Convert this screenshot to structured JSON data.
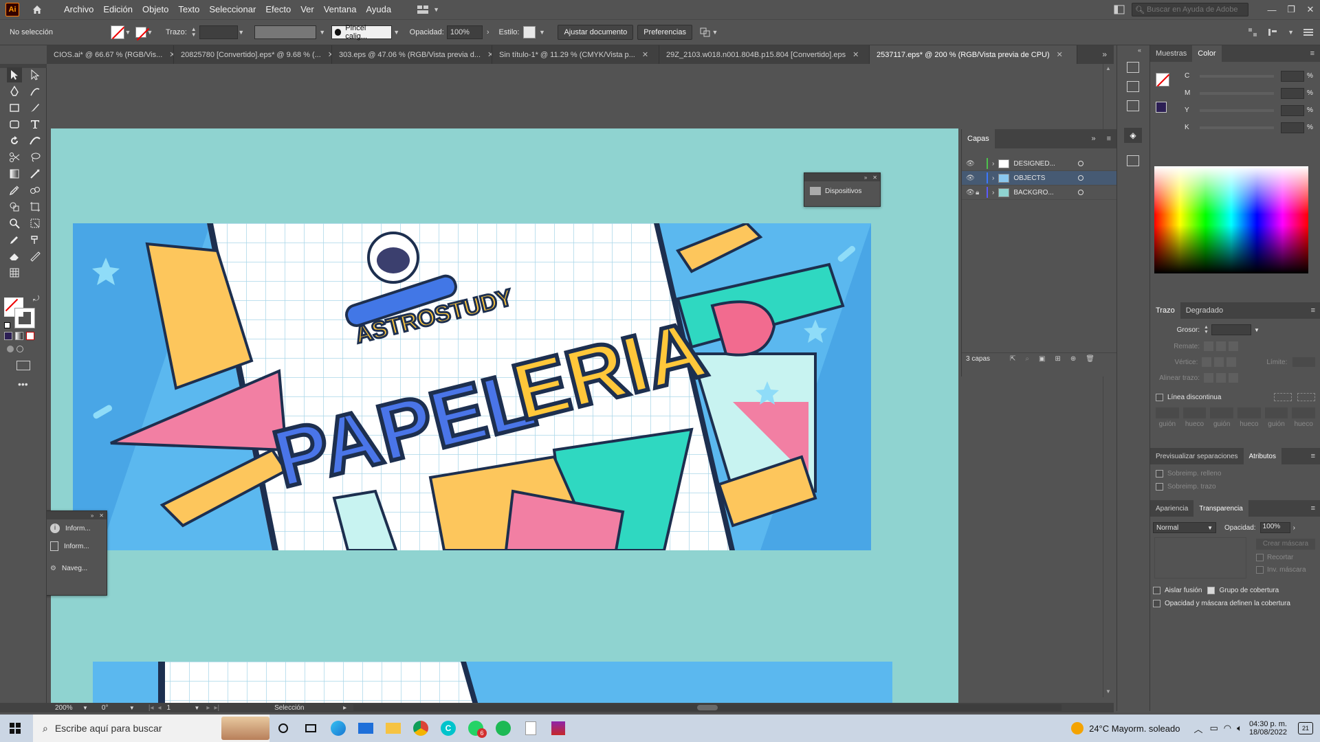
{
  "menu": {
    "logo": "Ai",
    "items": [
      "Archivo",
      "Edición",
      "Objeto",
      "Texto",
      "Seleccionar",
      "Efecto",
      "Ver",
      "Ventana",
      "Ayuda"
    ],
    "search_placeholder": "Buscar en Ayuda de Adobe"
  },
  "control": {
    "selection": "No selección",
    "stroke_label": "Trazo:",
    "brush": "Pincel calig...",
    "opacity_label": "Opacidad:",
    "opacity_value": "100%",
    "style_label": "Estilo:",
    "fit_button": "Ajustar documento",
    "prefs_button": "Preferencias"
  },
  "tabs": [
    {
      "label": "CIOS.ai* @ 66.67 % (RGB/Vis...",
      "active": false
    },
    {
      "label": "20825780 [Convertido].eps* @ 9.68 % (...",
      "active": false
    },
    {
      "label": "303.eps @ 47.06 % (RGB/Vista previa d...",
      "active": false
    },
    {
      "label": "Sin título-1* @ 11.29 % (CMYK/Vista p...",
      "active": false
    },
    {
      "label": "29Z_2103.w018.n001.804B.p15.804 [Convertido].eps",
      "active": false
    },
    {
      "label": "2537117.eps* @ 200 % (RGB/Vista previa de CPU)",
      "active": true
    }
  ],
  "artwork": {
    "small_title": "ASTROSTUDY",
    "big_title_a": "PAPEL",
    "big_title_b": "ERIA"
  },
  "devices_panel": {
    "label": "Dispositivos"
  },
  "info_panel": {
    "items": [
      "Inform...",
      "Inform...",
      "Naveg..."
    ]
  },
  "layers": {
    "tab": "Capas",
    "rows": [
      {
        "name": "DESIGNED...",
        "color": "#4dc24d"
      },
      {
        "name": "OBJECTS",
        "color": "#3c78ff"
      },
      {
        "name": "BACKGRO...",
        "color": "#5b5bff"
      }
    ],
    "count": "3 capas"
  },
  "color_panel": {
    "tabs": [
      "Muestras",
      "Color"
    ],
    "channels": [
      "C",
      "M",
      "Y",
      "K"
    ],
    "unit": "%"
  },
  "stroke_panel": {
    "tabs": [
      "Trazo",
      "Degradado"
    ],
    "weight_label": "Grosor:",
    "cap_label": "Remate:",
    "corner_label": "Vértice:",
    "limit_label": "Límite:",
    "align_label": "Alinear trazo:",
    "dashed_label": "Línea discontinua",
    "dash_fields": [
      "guión",
      "hueco",
      "guión",
      "hueco",
      "guión",
      "hueco"
    ]
  },
  "attr_panel": {
    "tabs": [
      "Previsualizar separaciones",
      "Atributos"
    ],
    "fill_overprint": "Sobreimp. relleno",
    "stroke_overprint": "Sobreimp. trazo"
  },
  "transparency_panel": {
    "tabs": [
      "Apariencia",
      "Transparencia"
    ],
    "mode": "Normal",
    "opacity_label": "Opacidad:",
    "opacity_value": "100%",
    "mask_button": "Crear máscara",
    "clip": "Recortar",
    "invert": "Inv. máscara",
    "isolate": "Aislar fusión",
    "knockout": "Grupo de cobertura",
    "opacity_mask": "Opacidad y máscara definen la cobertura"
  },
  "status": {
    "zoom": "200%",
    "rotation": "0°",
    "artboard": "1",
    "tool": "Selección"
  },
  "taskbar": {
    "search_placeholder": "Escribe aquí para buscar",
    "weather": "24°C  Mayorm. soleado",
    "time": "04:30 p. m.",
    "date": "18/08/2022",
    "notifications": "21",
    "whatsapp_badge": "6"
  }
}
